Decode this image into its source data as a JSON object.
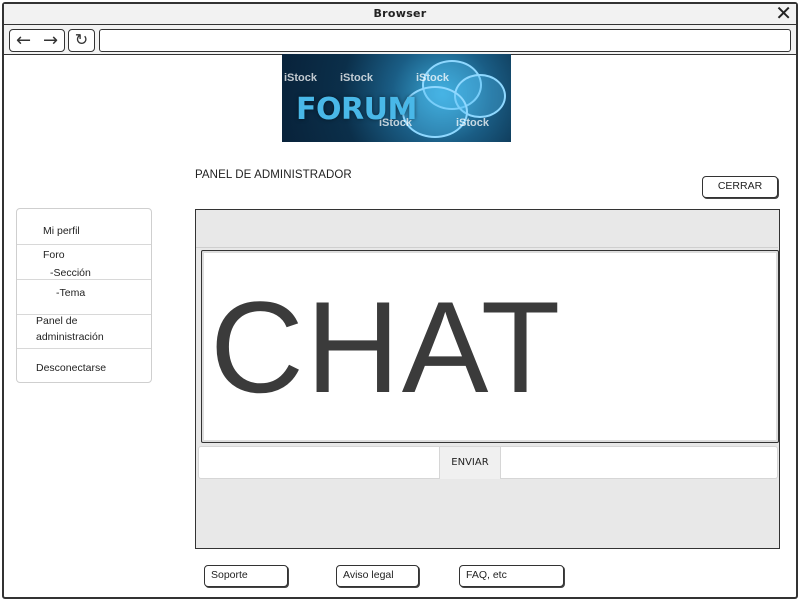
{
  "window": {
    "title": "Browser",
    "close_glyph": "✕"
  },
  "toolbar": {
    "back_glyph": "←",
    "forward_glyph": "→",
    "reload_glyph": "↻",
    "url": ""
  },
  "logo": {
    "text": "FORUM",
    "watermarks": [
      "iStock",
      "iStock",
      "iStock",
      "iStock",
      "iStock"
    ]
  },
  "panel": {
    "title": "PANEL DE ADMINISTRADOR",
    "close_label": "CERRAR"
  },
  "sidebar": {
    "items": [
      {
        "label": "Mi perfil"
      },
      {
        "label": "Foro"
      },
      {
        "label": "-Sección"
      },
      {
        "label": "-Tema"
      },
      {
        "label": "Panel de"
      },
      {
        "label": "administración"
      },
      {
        "label": "Desconectarse"
      }
    ]
  },
  "chat": {
    "heading": "CHAT",
    "send_label": "ENVIAR"
  },
  "footer": {
    "links": [
      "Soporte",
      "Aviso legal",
      "FAQ, etc"
    ]
  },
  "colors": {
    "content_bg": "#e8e8e8",
    "logo_accent": "#49b8e8"
  }
}
